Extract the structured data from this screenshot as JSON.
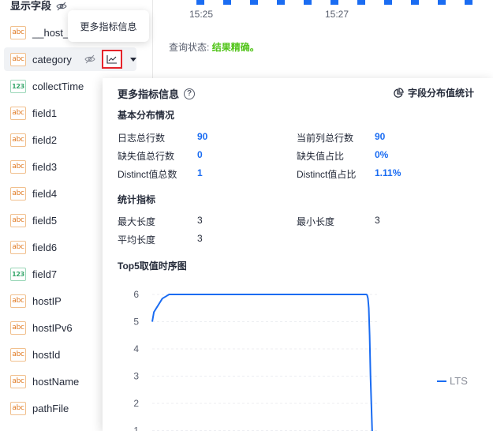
{
  "sidebar": {
    "header": "显示字段",
    "fields": [
      {
        "name": "__host_",
        "type": "abc"
      },
      {
        "name": "category",
        "type": "abc"
      },
      {
        "name": "collectTime",
        "type": "123"
      },
      {
        "name": "field1",
        "type": "abc"
      },
      {
        "name": "field2",
        "type": "abc"
      },
      {
        "name": "field3",
        "type": "abc"
      },
      {
        "name": "field4",
        "type": "abc"
      },
      {
        "name": "field5",
        "type": "abc"
      },
      {
        "name": "field6",
        "type": "abc"
      },
      {
        "name": "field7",
        "type": "123"
      },
      {
        "name": "hostIP",
        "type": "abc"
      },
      {
        "name": "hostIPv6",
        "type": "abc"
      },
      {
        "name": "hostId",
        "type": "abc"
      },
      {
        "name": "hostName",
        "type": "abc"
      },
      {
        "name": "pathFile",
        "type": "abc"
      }
    ]
  },
  "timeline": {
    "labels": [
      "15:25",
      "15:27"
    ]
  },
  "query": {
    "label": "查询状态:",
    "status": "结果精确。"
  },
  "tooltip": "更多指标信息",
  "panel": {
    "title": "更多指标信息",
    "help_icon": "?",
    "dist_link": "字段分布值统计",
    "basic": {
      "title": "基本分布情况",
      "rows": [
        {
          "label": "日志总行数",
          "value": "90",
          "label2": "当前列总行数",
          "value2": "90"
        },
        {
          "label": "缺失值总行数",
          "value": "0",
          "label2": "缺失值占比",
          "value2": "0%"
        },
        {
          "label": "Distinct值总数",
          "value": "1",
          "label2": "Distinct值占比",
          "value2": "1.11%"
        }
      ]
    },
    "metrics": {
      "title": "统计指标",
      "rows": [
        {
          "label": "最大长度",
          "value": "3",
          "label2": "最小长度",
          "value2": "3"
        },
        {
          "label": "平均长度",
          "value": "3"
        }
      ]
    },
    "top5_title": "Top5取值时序图"
  },
  "chart_data": {
    "type": "line",
    "title": "Top5取值时序图",
    "yticks": [
      1,
      2,
      3,
      4,
      5,
      6
    ],
    "series": [
      {
        "name": "LTS",
        "color": "#1a6cf2",
        "x": [
          0,
          0.1,
          0.6,
          0.95,
          1,
          1.4,
          1.8,
          2.2,
          2.6,
          3.0,
          3.8,
          5.6,
          12.65,
          12.7,
          12.75,
          12.8,
          12.85,
          12.9,
          12.95,
          13.05,
          13.2
        ],
        "y": [
          5.0,
          5.35,
          5.85,
          5.98,
          6,
          6,
          6,
          6,
          6,
          6,
          6,
          6,
          6,
          6,
          5.98,
          5.85,
          5.5,
          4.5,
          3.0,
          1.0,
          0.6
        ]
      }
    ]
  }
}
